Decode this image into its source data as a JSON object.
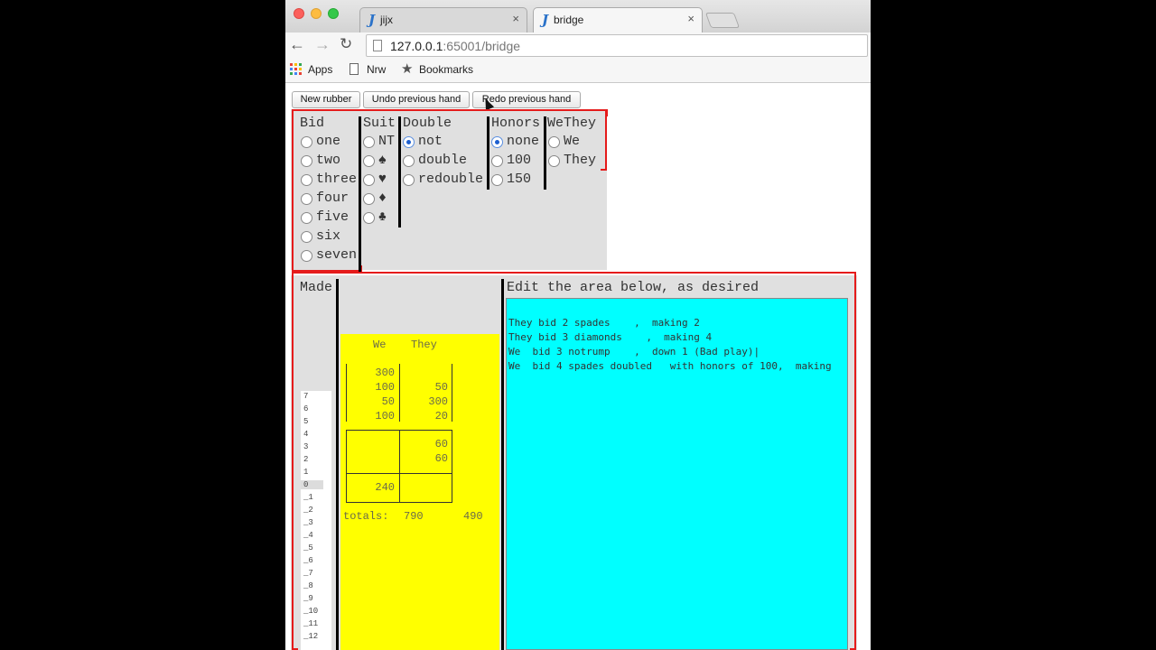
{
  "browser": {
    "tabs": [
      {
        "title": "jijx",
        "close": "×"
      },
      {
        "title": "bridge",
        "close": "×"
      }
    ],
    "tab_icon": "J",
    "url_host": "127.0.0.1",
    "url_rest": ":65001/bridge",
    "bookmarks": {
      "apps": "Apps",
      "nrw": "Nrw",
      "bookmarks": "Bookmarks"
    }
  },
  "buttons": {
    "new_rubber": "New rubber",
    "undo": "Undo previous hand",
    "redo": "Redo previous hand"
  },
  "bid": {
    "header": "Bid",
    "options": [
      "one",
      "two",
      "three",
      "four",
      "five",
      "six",
      "seven"
    ]
  },
  "suit": {
    "header": "Suit",
    "options": [
      "NT",
      "♠",
      "♥",
      "♦",
      "♣"
    ]
  },
  "double": {
    "header": "Double",
    "options": [
      "not",
      "double",
      "redouble"
    ],
    "selected": "not"
  },
  "honors": {
    "header": "Honors",
    "options": [
      "none",
      "100",
      "150"
    ],
    "selected": "none"
  },
  "wethey": {
    "header": "WeThey",
    "options": [
      "We",
      "They"
    ]
  },
  "made": {
    "header": "Made",
    "values": [
      "7",
      "6",
      "5",
      "4",
      "3",
      "2",
      "1",
      "0",
      "_1",
      "_2",
      "_3",
      "_4",
      "_5",
      "_6",
      "_7",
      "_8",
      "_9",
      "_10",
      "_11",
      "_12"
    ],
    "selected": "0"
  },
  "scoresheet": {
    "header_we": "We",
    "header_they": "They",
    "above_we": [
      "300",
      "100",
      "50",
      "100"
    ],
    "above_they": [
      "",
      "50",
      "300",
      "20"
    ],
    "below_game1_they": [
      "60",
      "60"
    ],
    "below_game2_we": "240",
    "totals_label": "totals:",
    "total_we": "790",
    "total_they": "490"
  },
  "editor": {
    "header": "Edit the area below, as desired",
    "lines": [
      "They bid 2 spades    ,  making 2",
      "They bid 3 diamonds    ,  making 4",
      "We  bid 3 notrump    ,  down 1 (Bad play)|",
      "We  bid 4 spades doubled   with honors of 100,  making"
    ]
  },
  "colors": {
    "score_bg": "#ffff00",
    "editor_bg": "#00ffff",
    "frame_red": "#e51b1b"
  }
}
